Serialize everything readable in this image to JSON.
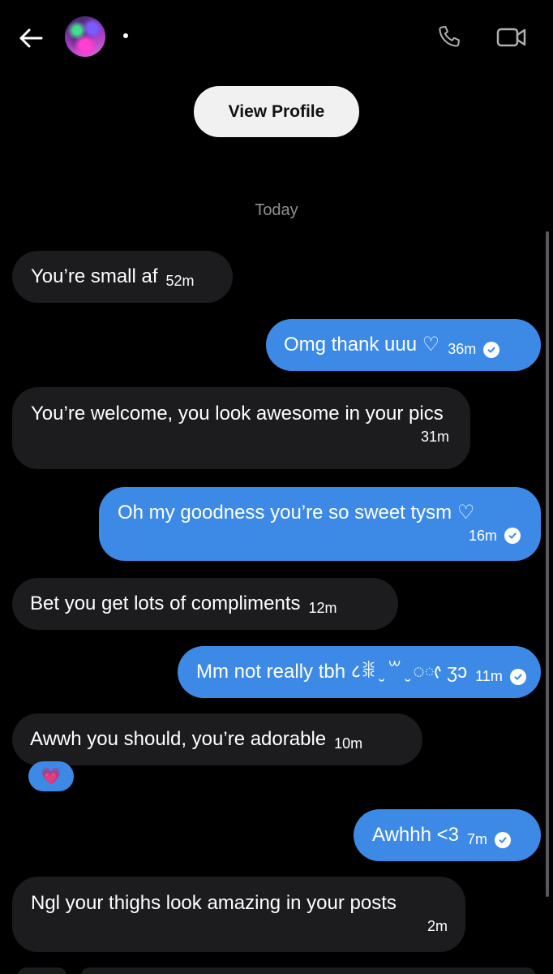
{
  "header": {
    "status_dot": "•",
    "back_icon": "arrow-left-icon",
    "call_icon": "phone-icon",
    "video_icon": "video-camera-icon"
  },
  "view_profile_label": "View Profile",
  "date_separator": "Today",
  "colors": {
    "background": "#000000",
    "incoming_bubble": "#1c1c1e",
    "outgoing_bubble": "#3d8ae6",
    "muted_text": "#8e8e93"
  },
  "messages": [
    {
      "direction": "incoming",
      "text": "You’re small af",
      "time": "52m"
    },
    {
      "direction": "outgoing",
      "text": "Omg thank uuu ♡",
      "time": "36m",
      "seen": true
    },
    {
      "direction": "incoming",
      "text": "You’re welcome, you look awesome in your pics",
      "time": "31m"
    },
    {
      "direction": "outgoing",
      "text": "Oh my goodness you’re so sweet tysm ♡",
      "time": "16m",
      "seen": true
    },
    {
      "direction": "incoming",
      "text": "Bet you get lots of compliments",
      "time": "12m"
    },
    {
      "direction": "outgoing",
      "text": "Mm not really tbh ८ꒌ ̮ ꒳ ̮ ◌ᰦ ʒɔ",
      "time": "11m",
      "seen": true
    },
    {
      "direction": "incoming",
      "text": "Awwh you should, you’re adorable",
      "time": "10m",
      "reaction": "💗"
    },
    {
      "direction": "outgoing",
      "text": "Awhhh <3",
      "time": "7m",
      "seen": true
    },
    {
      "direction": "incoming",
      "text": "Ngl your thighs look amazing in your posts",
      "time": "2m"
    }
  ]
}
